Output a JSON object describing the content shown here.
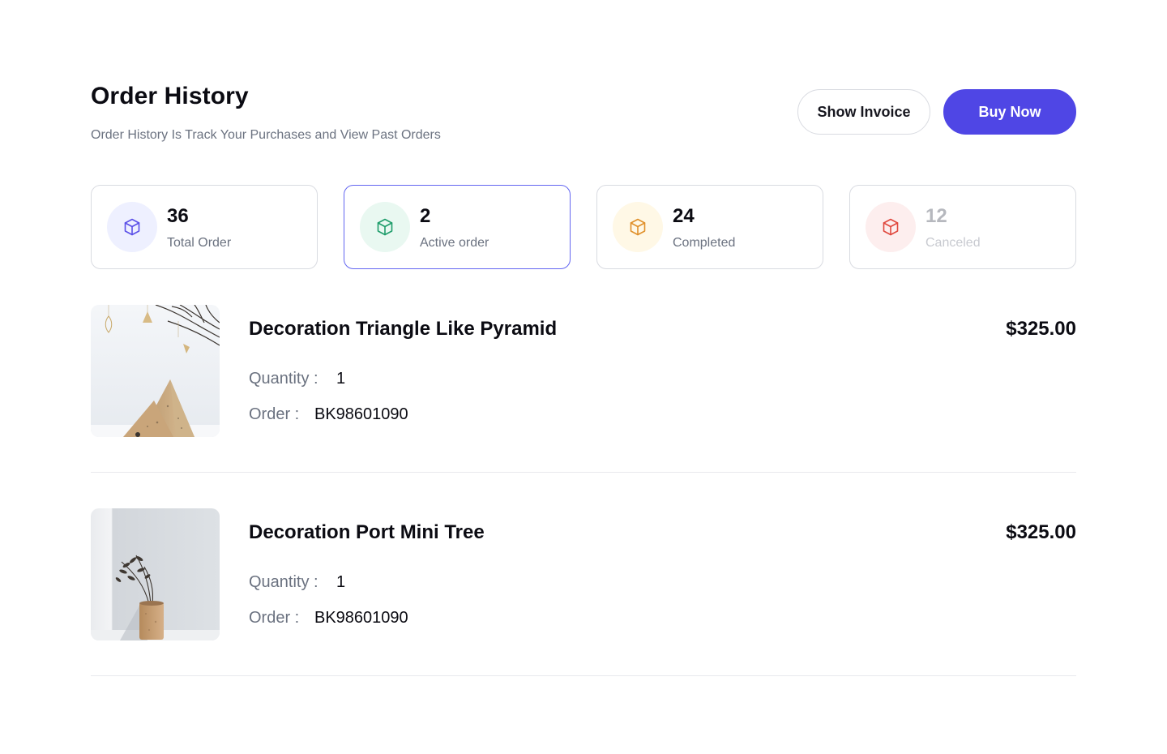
{
  "header": {
    "title": "Order History",
    "subtitle": "Order History Is Track Your Purchases and View Past Orders",
    "show_invoice_label": "Show Invoice",
    "buy_now_label": "Buy Now"
  },
  "stats": [
    {
      "value": "36",
      "label": "Total Order",
      "icon": "box-icon",
      "color": "#5b50e8",
      "bg": "#eef0ff"
    },
    {
      "value": "2",
      "label": "Active order",
      "icon": "box-icon",
      "color": "#1f9d6b",
      "bg": "#e9f8f1"
    },
    {
      "value": "24",
      "label": "Completed",
      "icon": "box-icon",
      "color": "#e0902a",
      "bg": "#fff8e6"
    },
    {
      "value": "12",
      "label": "Canceled",
      "icon": "box-icon",
      "color": "#e0483e",
      "bg": "#fdeeee"
    }
  ],
  "orders": [
    {
      "name": "Decoration Triangle Like Pyramid",
      "price": "$325.00",
      "quantity_label": "Quantity :",
      "quantity": "1",
      "order_label": "Order :",
      "order_id": "BK98601090",
      "image": "pyramid-decoration-photo"
    },
    {
      "name": "Decoration Port Mini Tree",
      "price": "$325.00",
      "quantity_label": "Quantity :",
      "quantity": "1",
      "order_label": "Order :",
      "order_id": "BK98601090",
      "image": "mini-tree-vase-photo"
    }
  ],
  "colors": {
    "primary": "#4f46e5",
    "active_border": "#6366f1",
    "muted_text": "#6b7280",
    "border": "#d9dbe1"
  }
}
